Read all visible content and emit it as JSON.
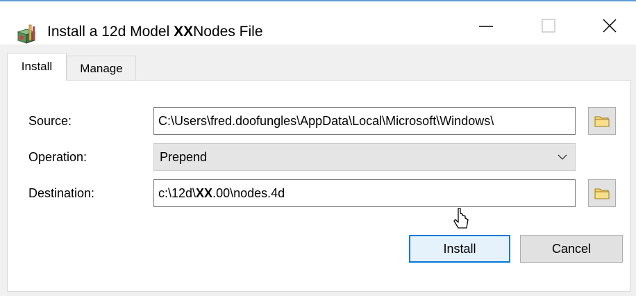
{
  "window": {
    "title_prefix": "Install a 12d Model ",
    "title_mark": "XX",
    "title_suffix": "Nodes File",
    "icon": "12d-model-app-icon",
    "controls": {
      "minimize": "minimize-icon",
      "maximize": "maximize-icon",
      "close": "close-icon"
    }
  },
  "tabs": [
    {
      "label": "Install",
      "active": true
    },
    {
      "label": "Manage",
      "active": false
    }
  ],
  "form": {
    "source_label": "Source:",
    "source_value": "C:\\Users\\fred.doofungles\\AppData\\Local\\Microsoft\\Windows\\",
    "operation_label": "Operation:",
    "operation_value": "Prepend",
    "destination_label": "Destination:",
    "destination_prefix": "c:\\12d\\",
    "destination_mark": "XX",
    "destination_suffix": ".00\\nodes.4d",
    "browse_icon": "folder-icon"
  },
  "buttons": {
    "install_label": "Install",
    "cancel_label": "Cancel"
  },
  "colors": {
    "accent": "#0078d7",
    "title_accent_line": "#5b9bd5",
    "window_bg": "#f0f0f0",
    "folder": "#f5d270"
  }
}
